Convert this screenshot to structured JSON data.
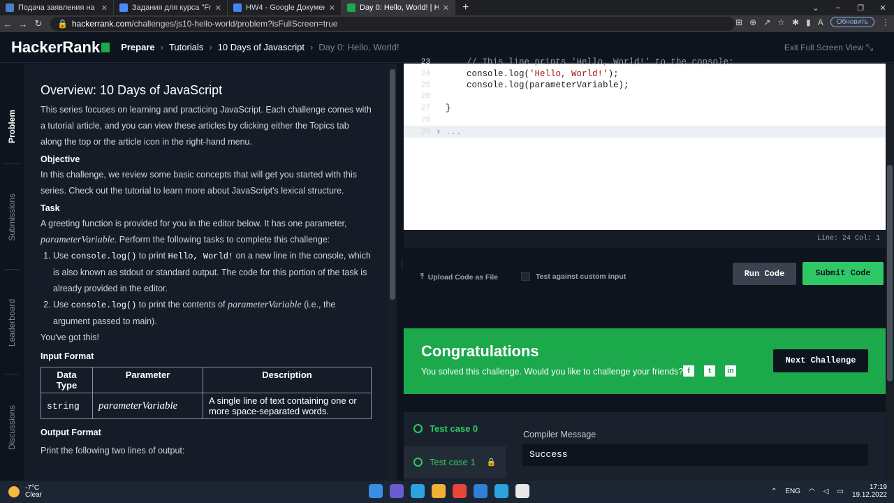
{
  "browser": {
    "tabs": [
      {
        "title": "Подача заявления на постанов",
        "color": "#4a7ec9"
      },
      {
        "title": "Задания для курса \"Frontend ра",
        "color": "#4b8bf5"
      },
      {
        "title": "HW4 - Google Документы",
        "color": "#4285f4"
      },
      {
        "title": "Day 0: Hello, World! | HackerRan",
        "color": "#1ba94c"
      }
    ],
    "url_host": "hackerrank.com",
    "url_path": "/challenges/js10-hello-world/problem?isFullScreen=true",
    "update_label": "Обновить",
    "avatar_letter": "A"
  },
  "header": {
    "logo": "HackerRank",
    "crumb_prepare": "Prepare",
    "crumb_tutorials": "Tutorials",
    "crumb_series": "10 Days of Javascript",
    "crumb_current": "Day 0: Hello, World!",
    "exit_fullscreen": "Exit Full Screen View"
  },
  "sidebar": {
    "items": [
      "Problem",
      "Submissions",
      "Leaderboard",
      "Discussions"
    ]
  },
  "problem": {
    "title": "Overview: 10 Days of JavaScript",
    "intro": "This series focuses on learning and practicing JavaScript. Each challenge comes with a tutorial article, and you can view these articles by clicking either the Topics tab along the top or the article icon in the right-hand menu.",
    "objective_heading": "Objective",
    "objective_text": "In this challenge, we review some basic concepts that will get you started with this series. Check out the tutorial to learn more about JavaScript's lexical structure.",
    "task_heading": "Task",
    "task_intro_1": "A greeting function is provided for you in the editor below. It has one parameter,",
    "param_name": "parameterVariable",
    "task_intro_2": ". Perform the following tasks to complete this challenge:",
    "task1_a": "Use ",
    "task1_code1": "console.log()",
    "task1_b": " to print ",
    "task1_code2": "Hello, World!",
    "task1_c": " on a new line in the console, which is also known as stdout or standard output. The code for this portion of the task is already provided in the editor.",
    "task2_a": "Use ",
    "task2_code1": "console.log()",
    "task2_b": " to print the contents of ",
    "task2_param": "parameterVariable",
    "task2_c": " (i.e., the argument passed to main).",
    "encourage": "You've got this!",
    "input_heading": "Input Format",
    "table_headers": [
      "Data Type",
      "Parameter",
      "Description"
    ],
    "table_row": [
      "string",
      "parameterVariable",
      "A single line of text containing one or more space-separated words."
    ],
    "output_heading": "Output Format",
    "output_partial": "Print the following two lines of output:"
  },
  "editor": {
    "lines": [
      {
        "n": "23",
        "text": "    // This line prints 'Hello, World!' to the console:",
        "kind": "comment"
      },
      {
        "n": "24",
        "text": "    console.log('Hello, World!');",
        "kind": "string"
      },
      {
        "n": "25",
        "text": "    console.log(parameterVariable);",
        "kind": "plain"
      },
      {
        "n": "26",
        "text": "",
        "kind": "plain"
      },
      {
        "n": "27",
        "text": "}",
        "kind": "plain"
      },
      {
        "n": "28",
        "text": "",
        "kind": "plain"
      },
      {
        "n": "29",
        "text": "...",
        "kind": "fold"
      }
    ],
    "status": "Line: 24 Col: 1"
  },
  "actions": {
    "upload": "Upload Code as File",
    "custom_input": "Test against custom input",
    "run": "Run Code",
    "submit": "Submit Code"
  },
  "congrats": {
    "title": "Congratulations",
    "text": "You solved this challenge. Would you like to challenge your friends?",
    "next": "Next Challenge"
  },
  "results": {
    "tests": [
      "Test case 0",
      "Test case 1"
    ],
    "compiler_heading": "Compiler Message",
    "compiler_message": "Success"
  },
  "taskbar": {
    "temp": "-7°C",
    "weather": "Clear",
    "lang": "ENG",
    "time": "17:19",
    "date": "19.12.2022"
  }
}
